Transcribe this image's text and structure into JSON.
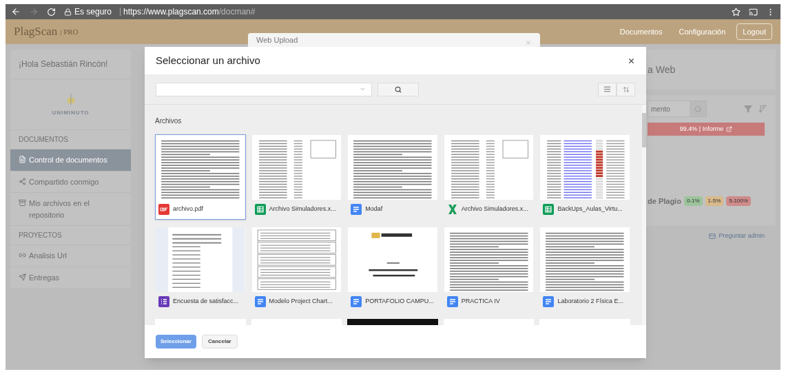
{
  "browser": {
    "secure_label": "Es seguro",
    "url_host": "https://www.plagscan.com",
    "url_path": "/docman#"
  },
  "header": {
    "logo": "PlagScan",
    "logo_suffix": "| PRO",
    "nav": [
      "Documentos",
      "Configuración"
    ],
    "logout": "Logout"
  },
  "sidebar": {
    "greeting": "¡Hola Sebastián Rincón!",
    "org_logo": "UNIMINUTO",
    "sections": [
      {
        "title": "DOCUMENTOS",
        "items": [
          {
            "label": "Control de documentos",
            "selected": true
          },
          {
            "label": "Compartido conmigo",
            "selected": false
          },
          {
            "label": "Mis archivos en el repositorio",
            "selected": false
          }
        ]
      },
      {
        "title": "PROYECTOS",
        "items": [
          {
            "label": "Analisis Url",
            "selected": false
          },
          {
            "label": "Entregas",
            "selected": false
          }
        ]
      }
    ]
  },
  "right_panel": {
    "title_fragment": "a Web",
    "search_value": "mento",
    "report": "99.4% | Informe",
    "plagio_label": "de Plagio",
    "badges": [
      {
        "label": "0-1%",
        "color": "#9cc49c"
      },
      {
        "label": "1-5%",
        "color": "#d8b98a"
      },
      {
        "label": "5-100%",
        "color": "#cf8a8a"
      }
    ],
    "ask_admin": "Preguntar admin"
  },
  "back_dialog": {
    "title": "Web Upload"
  },
  "dialog": {
    "title": "Seleccionar un archivo",
    "section_title": "Archivos",
    "files": [
      {
        "name": "archivo.pdf",
        "kind": "pdf",
        "selected": true
      },
      {
        "name": "Archivo Simuladores.x...",
        "kind": "sheet",
        "selected": false
      },
      {
        "name": "Modaf",
        "kind": "doc",
        "selected": false
      },
      {
        "name": "Archivo Simuladores.x...",
        "kind": "excel",
        "selected": false
      },
      {
        "name": "BackUps_Aulas_Virtu...",
        "kind": "sheet",
        "selected": false
      },
      {
        "name": "Encuesta de satisfacc...",
        "kind": "form",
        "selected": false
      },
      {
        "name": "Modelo Project Chart...",
        "kind": "doc",
        "selected": false
      },
      {
        "name": "PORTAFOLIO CAMPU...",
        "kind": "doc",
        "selected": false
      },
      {
        "name": "PRACTICA IV",
        "kind": "doc",
        "selected": false
      },
      {
        "name": "Laboratorio 2 Física E...",
        "kind": "doc",
        "selected": false
      }
    ],
    "select_button": {
      "label": "Seleccionar",
      "disabled": true
    },
    "cancel_button": "Cancelar"
  }
}
